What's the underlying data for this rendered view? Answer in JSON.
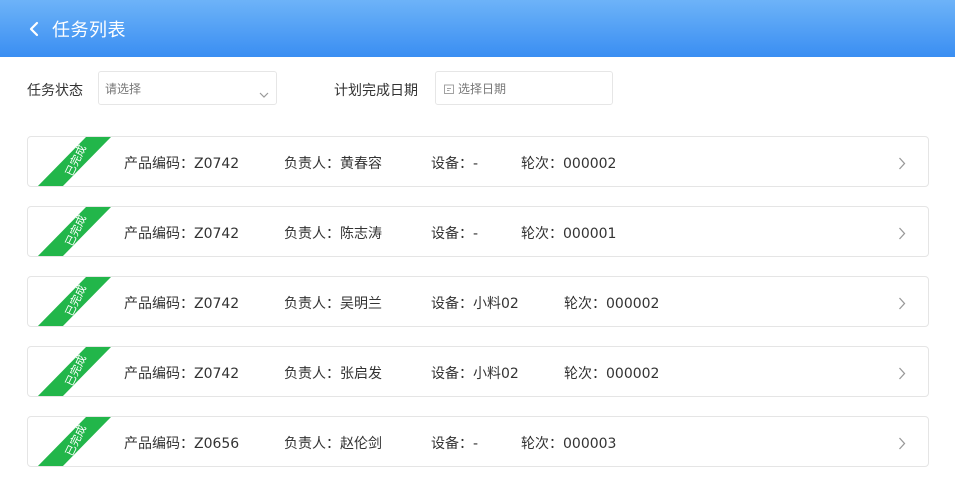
{
  "header": {
    "title": "任务列表"
  },
  "filters": {
    "status_label": "任务状态",
    "status_placeholder": "请选择",
    "date_label": "计划完成日期",
    "date_placeholder": "选择日期"
  },
  "tasks": [
    {
      "badge": "已完成",
      "code_label": "产品编码：Z0742",
      "owner_label": "负责人：黄春容",
      "device_label": "设备：-",
      "round_label": "轮次：000002"
    },
    {
      "badge": "已完成",
      "code_label": "产品编码：Z0742",
      "owner_label": "负责人：陈志涛",
      "device_label": "设备：-",
      "round_label": "轮次：000001"
    },
    {
      "badge": "已完成",
      "code_label": "产品编码：Z0742",
      "owner_label": "负责人：吴明兰",
      "device_label": "设备：小料02",
      "round_label": "轮次：000002"
    },
    {
      "badge": "已完成",
      "code_label": "产品编码：Z0742",
      "owner_label": "负责人：张启发",
      "device_label": "设备：小料02",
      "round_label": "轮次：000002"
    },
    {
      "badge": "已完成",
      "code_label": "产品编码：Z0656",
      "owner_label": "负责人：赵伦剑",
      "device_label": "设备：-",
      "round_label": "轮次：000003"
    }
  ],
  "colors": {
    "header_top": "#6db3f8",
    "header_bottom": "#3a8ef2",
    "badge_green": "#22b64a"
  },
  "icons": {
    "back": "chevron-left-icon",
    "select_arrow": "chevron-down-icon",
    "calendar": "calendar-icon",
    "row_arrow": "chevron-right-icon"
  }
}
